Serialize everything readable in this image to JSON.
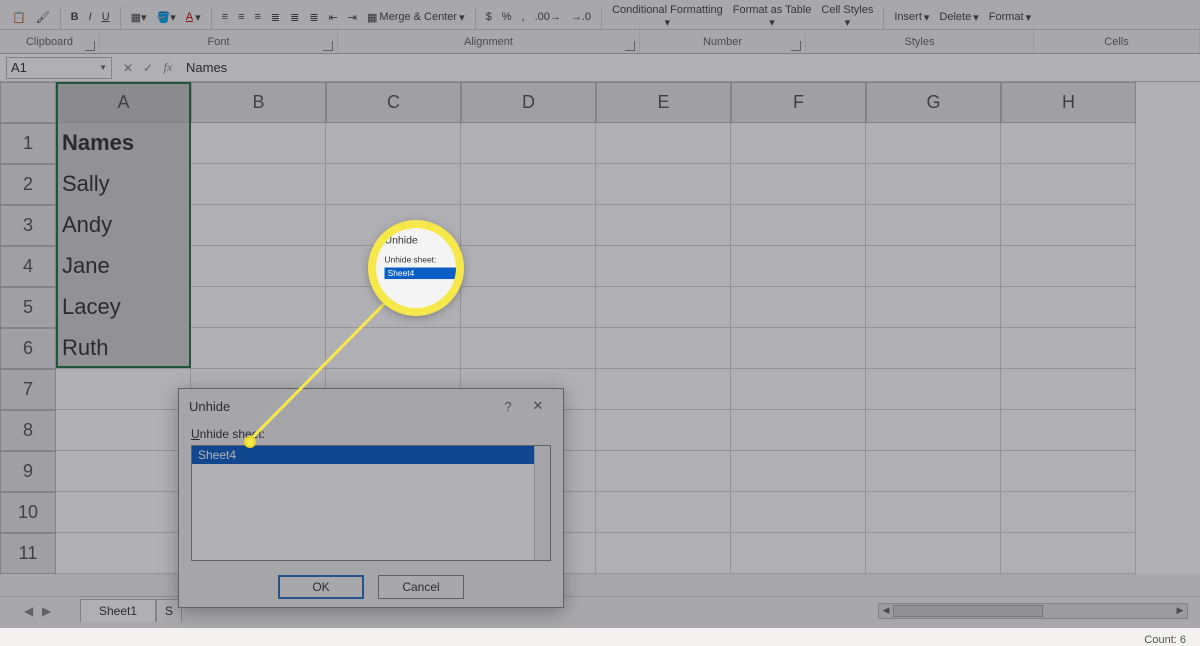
{
  "ribbon": {
    "groups": {
      "clipboard": "Clipboard",
      "font": "Font",
      "alignment": "Alignment",
      "number": "Number",
      "styles": "Styles",
      "cells": "Cells"
    },
    "buttons": {
      "bold": "B",
      "italic": "I",
      "underline": "U",
      "merge": "Merge & Center",
      "currency": "$",
      "percent": "%",
      "comma": ",",
      "cond_format": "Conditional Formatting",
      "format_table": "Format as Table",
      "cell_styles": "Cell Styles",
      "insert": "Insert",
      "delete": "Delete",
      "format": "Format"
    }
  },
  "namebox": "A1",
  "formula": "Names",
  "columns": [
    "A",
    "B",
    "C",
    "D",
    "E",
    "F",
    "G",
    "H"
  ],
  "rows": [
    "1",
    "2",
    "3",
    "4",
    "5",
    "6",
    "7",
    "8",
    "9",
    "10",
    "11"
  ],
  "cells": {
    "A1": "Names",
    "A2": "Sally",
    "A3": "Andy",
    "A4": "Jane",
    "A5": "Lacey",
    "A6": "Ruth"
  },
  "sheet_tabs": [
    "Sheet1",
    "S"
  ],
  "status": {
    "count": "Count: 6"
  },
  "dialog": {
    "title": "Unhide",
    "label_prefix": "U",
    "label_rest": "nhide sheet:",
    "items": [
      "Sheet4"
    ],
    "ok": "OK",
    "cancel": "Cancel",
    "help": "?",
    "close": "✕"
  },
  "magnifier": {
    "title": "Unhide",
    "label": "Unhide sheet:",
    "item": "Sheet4"
  }
}
